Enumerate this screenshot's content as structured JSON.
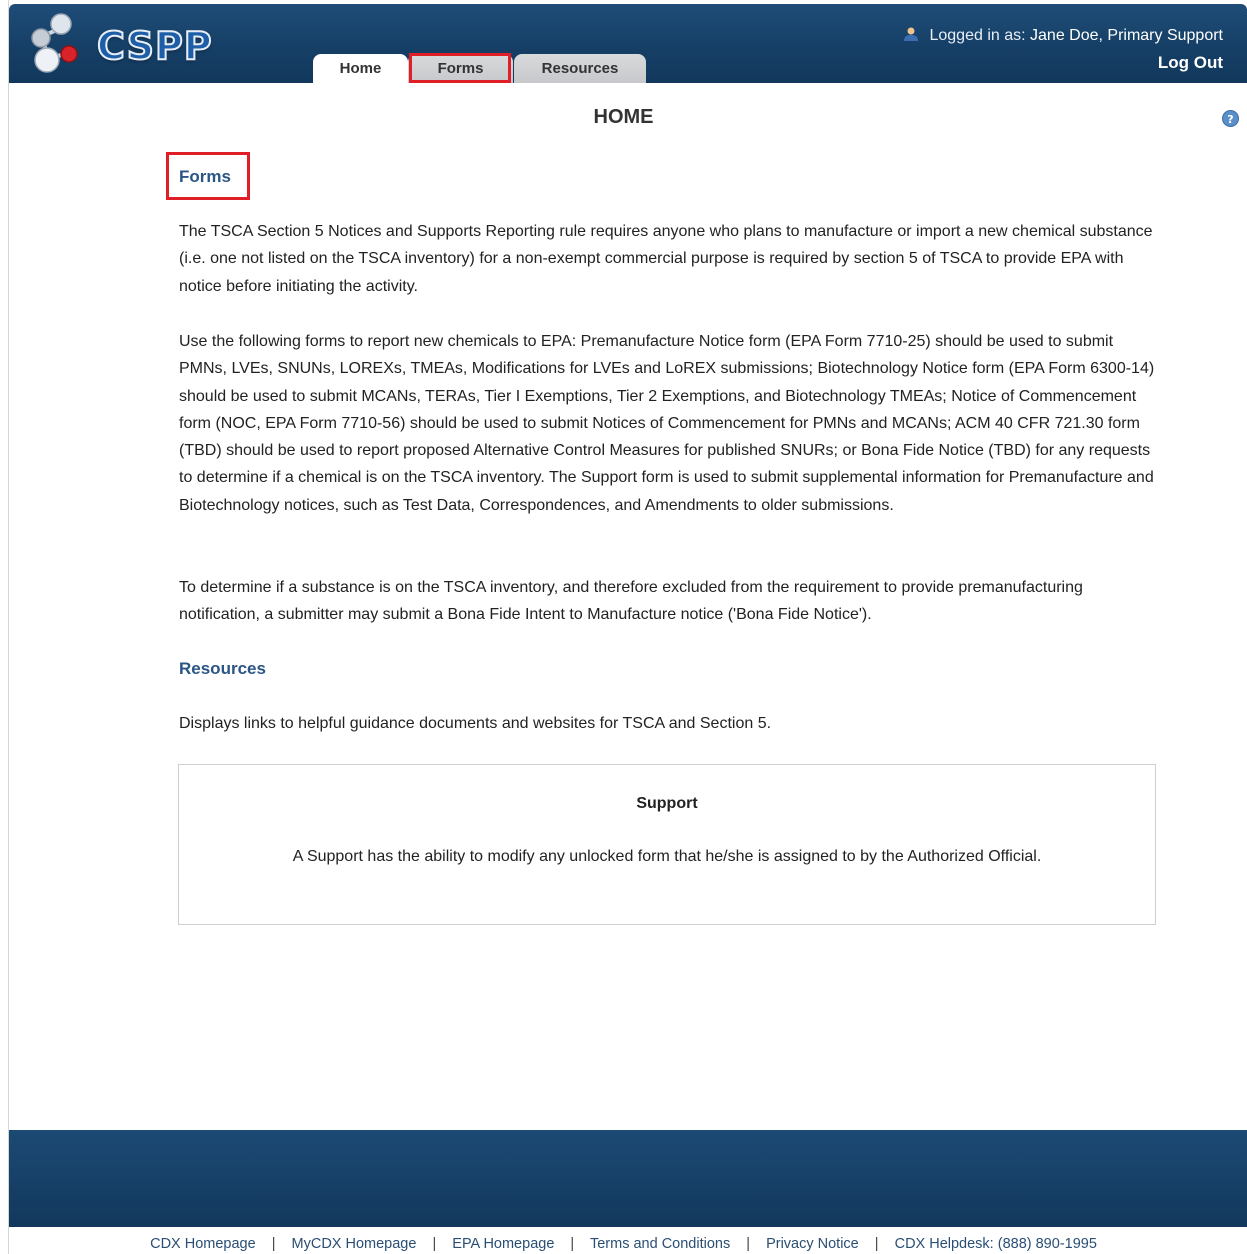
{
  "header": {
    "logo_text": "CSPP",
    "tabs": [
      {
        "label": "Home",
        "active": true
      },
      {
        "label": "Forms",
        "active": false,
        "highlighted": true
      },
      {
        "label": "Resources",
        "active": false
      }
    ],
    "user_prefix": "Logged in as:",
    "user_name": "Jane Doe, Primary Support",
    "logout_label": "Log Out"
  },
  "main": {
    "title": "HOME",
    "forms_heading": "Forms",
    "forms_paragraphs": [
      "The TSCA Section 5 Notices and Supports Reporting rule requires anyone who plans to manufacture or import a new chemical substance (i.e. one not listed on the TSCA inventory) for a non-exempt commercial purpose is required by section 5 of TSCA to provide EPA with notice before initiating the activity.",
      "Use the following forms to report new chemicals to EPA: Premanufacture Notice form (EPA Form 7710-25) should be used to submit PMNs, LVEs, SNUNs, LOREXs, TMEAs, Modifications for LVEs and LoREX submissions; Biotechnology Notice form (EPA Form 6300-14) should be used to submit MCANs, TERAs, Tier I Exemptions, Tier 2 Exemptions, and Biotechnology TMEAs; Notice of Commencement form (NOC, EPA Form 7710-56) should be used to submit Notices of Commencement for PMNs and MCANs; ACM 40 CFR 721.30 form (TBD) should be used to report proposed Alternative Control Measures for published SNURs; or Bona Fide Notice (TBD) for any requests to determine if a chemical is on the TSCA inventory. The Support form is used to submit supplemental information for Premanufacture and Biotechnology notices, such as Test Data, Correspondences, and Amendments to older submissions.",
      "To determine if a substance is on the TSCA inventory, and therefore excluded from the requirement to provide premanufacturing notification, a submitter may submit a Bona Fide Intent to Manufacture notice ('Bona Fide Notice')."
    ],
    "resources_heading": "Resources",
    "resources_text": "Displays links to helpful guidance documents and websites for TSCA and Section 5.",
    "support_box": {
      "title": "Support",
      "text": "A Support has the ability to modify any unlocked form that he/she is assigned to by the Authorized Official."
    }
  },
  "footer": {
    "links": [
      "CDX Homepage",
      "MyCDX Homepage",
      "EPA Homepage",
      "Terms and Conditions",
      "Privacy Notice",
      "CDX Helpdesk: (888) 890-1995"
    ],
    "separator": "|"
  },
  "colors": {
    "header_blue": "#163f66",
    "heading_blue": "#2a5585",
    "highlight_red": "#e01e25"
  },
  "icons": {
    "logo": "molecule-icon",
    "user": "user-icon",
    "help": "help-icon"
  }
}
